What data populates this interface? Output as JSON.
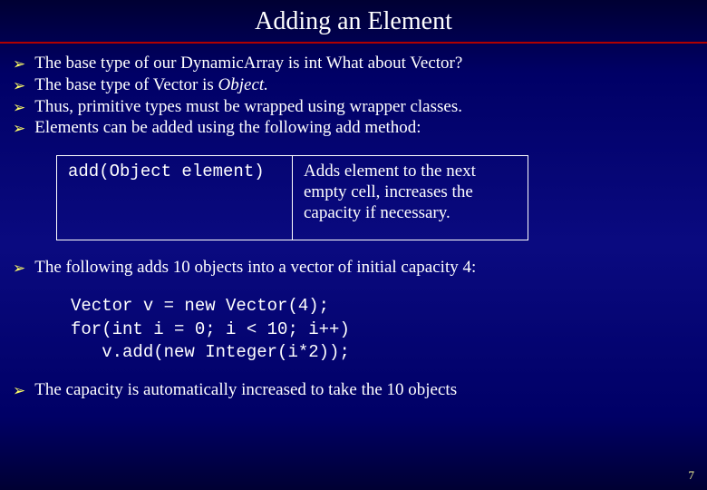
{
  "title": "Adding an Element",
  "bullets_top": [
    "The base type of our DynamicArray is int What about Vector?",
    "The base type of Vector is ",
    "Thus, primitive types must be wrapped using wrapper classes.",
    "Elements can be added using the following add method:"
  ],
  "object_italic": "Object.",
  "table": {
    "signature": "add(Object element)",
    "description": "Adds element to the next empty cell, increases the capacity if necessary."
  },
  "bullets_mid": [
    "The following adds 10 objects into a vector of initial capacity 4:"
  ],
  "code": "Vector v = new Vector(4);\nfor(int i = 0; i < 10; i++)\n   v.add(new Integer(i*2));",
  "bullets_bot": [
    "The capacity is automatically increased to take the 10 objects"
  ],
  "page_number": "7",
  "bullet_glyph": "➢"
}
